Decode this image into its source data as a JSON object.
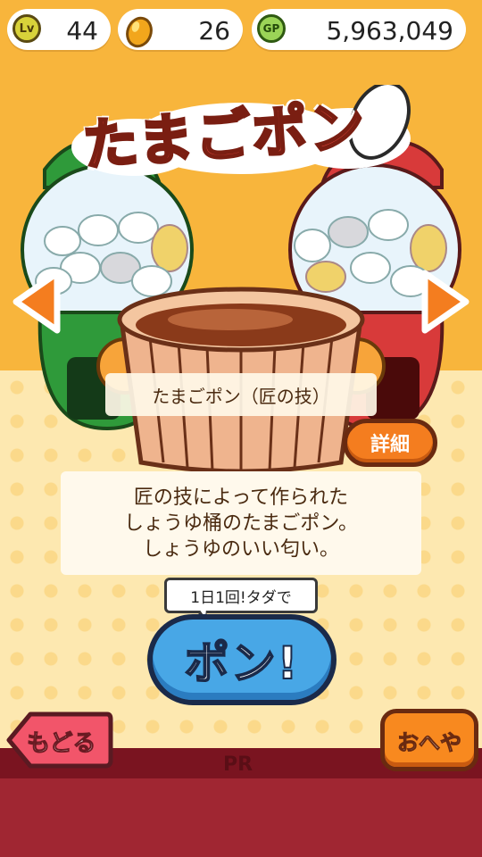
{
  "status": {
    "level_icon": "Lv",
    "level": "44",
    "egg_count": "26",
    "gp_icon": "GP",
    "gp": "5,963,049"
  },
  "title": "たまごポン",
  "machine": {
    "name": "たまごポン（匠の技）",
    "detail_label": "詳細",
    "description": [
      "匠の技によって作られた",
      "しょうゆ桶のたまごポン。",
      "しょうゆのいい匂い。"
    ]
  },
  "free_note": "1日1回!タダで",
  "pon_label": "ポン!",
  "back_label": "もどる",
  "room_label": "おへや",
  "ad_label": "PR",
  "colors": {
    "wall": "#f8b53c",
    "floor": "#fde8b0",
    "pon": "#48a7e6",
    "back": "#f2556a",
    "room": "#f8891f",
    "ad": "#a02632"
  }
}
